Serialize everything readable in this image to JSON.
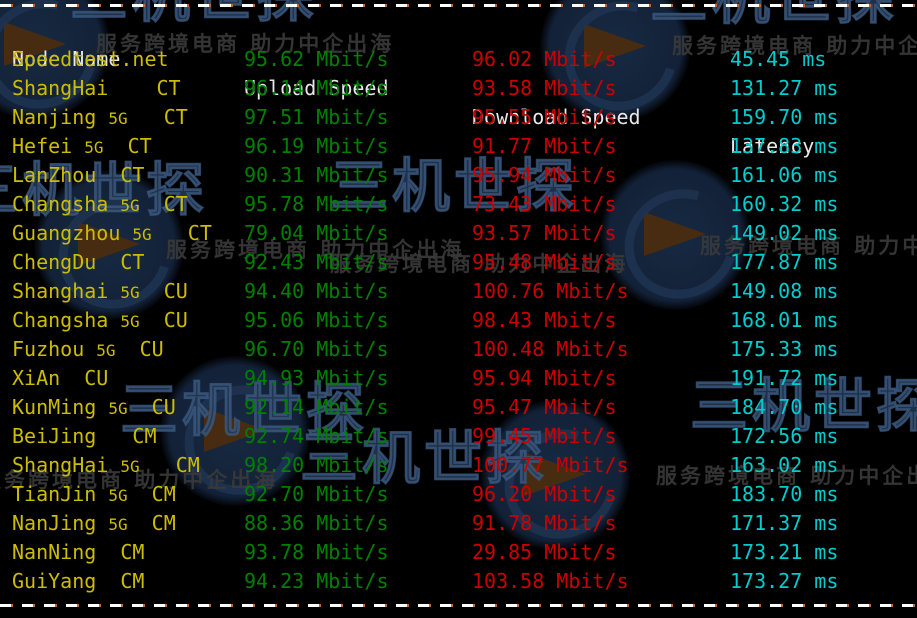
{
  "terminal": {
    "background_color": "#000000",
    "rule_top": "--------------------------------------------------------------------------",
    "rule_bottom": "--------------------------------------------------------------------------"
  },
  "watermark": {
    "brand_big": "三机世探",
    "tagline": "服务跨境电商 助力中企出海",
    "logo_name": "globe-arrow-logo"
  },
  "colors": {
    "header": "#e8e8e8",
    "node": "#cdbd00",
    "upload": "#008000",
    "download": "#cc0000",
    "latency": "#00cdcd",
    "rule": "#ffffff"
  },
  "table": {
    "headers": {
      "node": "Node Name",
      "upload": "Upload Speed",
      "download": "Download Speed",
      "latency": "Latency"
    },
    "units": {
      "speed": "Mbit/s",
      "latency": "ms"
    },
    "rows": [
      {
        "node": "Speedtest.net",
        "upload": "95.62 Mbit/s",
        "download": "96.02 Mbit/s",
        "latency": "45.45 ms"
      },
      {
        "node": "ShangHai    CT",
        "upload": "96.14 Mbit/s",
        "download": "93.58 Mbit/s",
        "latency": "131.27 ms"
      },
      {
        "node": "Nanjing 5G   CT",
        "upload": "97.51 Mbit/s",
        "download": "95.55 Mbit/s",
        "latency": "159.70 ms"
      },
      {
        "node": "Hefei 5G  CT",
        "upload": "96.19 Mbit/s",
        "download": "91.77 Mbit/s",
        "latency": "137.83 ms"
      },
      {
        "node": "LanZhou  CT",
        "upload": "90.31 Mbit/s",
        "download": "95.94 Mbit/s",
        "latency": "161.06 ms"
      },
      {
        "node": "Changsha 5G  CT",
        "upload": "95.78 Mbit/s",
        "download": "73.43 Mbit/s",
        "latency": "160.32 ms"
      },
      {
        "node": "Guangzhou 5G   CT",
        "upload": "79.04 Mbit/s",
        "download": "93.57 Mbit/s",
        "latency": "149.02 ms"
      },
      {
        "node": "ChengDu  CT",
        "upload": "92.43 Mbit/s",
        "download": "95.48 Mbit/s",
        "latency": "177.87 ms"
      },
      {
        "node": "Shanghai 5G  CU",
        "upload": "94.40 Mbit/s",
        "download": "100.76 Mbit/s",
        "latency": "149.08 ms"
      },
      {
        "node": "Changsha 5G  CU",
        "upload": "95.06 Mbit/s",
        "download": "98.43 Mbit/s",
        "latency": "168.01 ms"
      },
      {
        "node": "Fuzhou 5G  CU",
        "upload": "96.70 Mbit/s",
        "download": "100.48 Mbit/s",
        "latency": "175.33 ms"
      },
      {
        "node": "XiAn  CU",
        "upload": "94.93 Mbit/s",
        "download": "95.94 Mbit/s",
        "latency": "191.72 ms"
      },
      {
        "node": "KunMing 5G  CU",
        "upload": "92.14 Mbit/s",
        "download": "95.47 Mbit/s",
        "latency": "184.70 ms"
      },
      {
        "node": "BeiJing   CM",
        "upload": "92.74 Mbit/s",
        "download": "99.45 Mbit/s",
        "latency": "172.56 ms"
      },
      {
        "node": "ShangHai 5G   CM",
        "upload": "98.20 Mbit/s",
        "download": "100.77 Mbit/s",
        "latency": "163.02 ms"
      },
      {
        "node": "TianJin 5G  CM",
        "upload": "92.70 Mbit/s",
        "download": "96.20 Mbit/s",
        "latency": "183.70 ms"
      },
      {
        "node": "NanJing 5G  CM",
        "upload": "88.36 Mbit/s",
        "download": "91.78 Mbit/s",
        "latency": "171.37 ms"
      },
      {
        "node": "NanNing  CM",
        "upload": "93.78 Mbit/s",
        "download": "29.85 Mbit/s",
        "latency": "173.21 ms"
      },
      {
        "node": "GuiYang  CM",
        "upload": "94.23 Mbit/s",
        "download": "103.58 Mbit/s",
        "latency": "173.27 ms"
      }
    ]
  }
}
